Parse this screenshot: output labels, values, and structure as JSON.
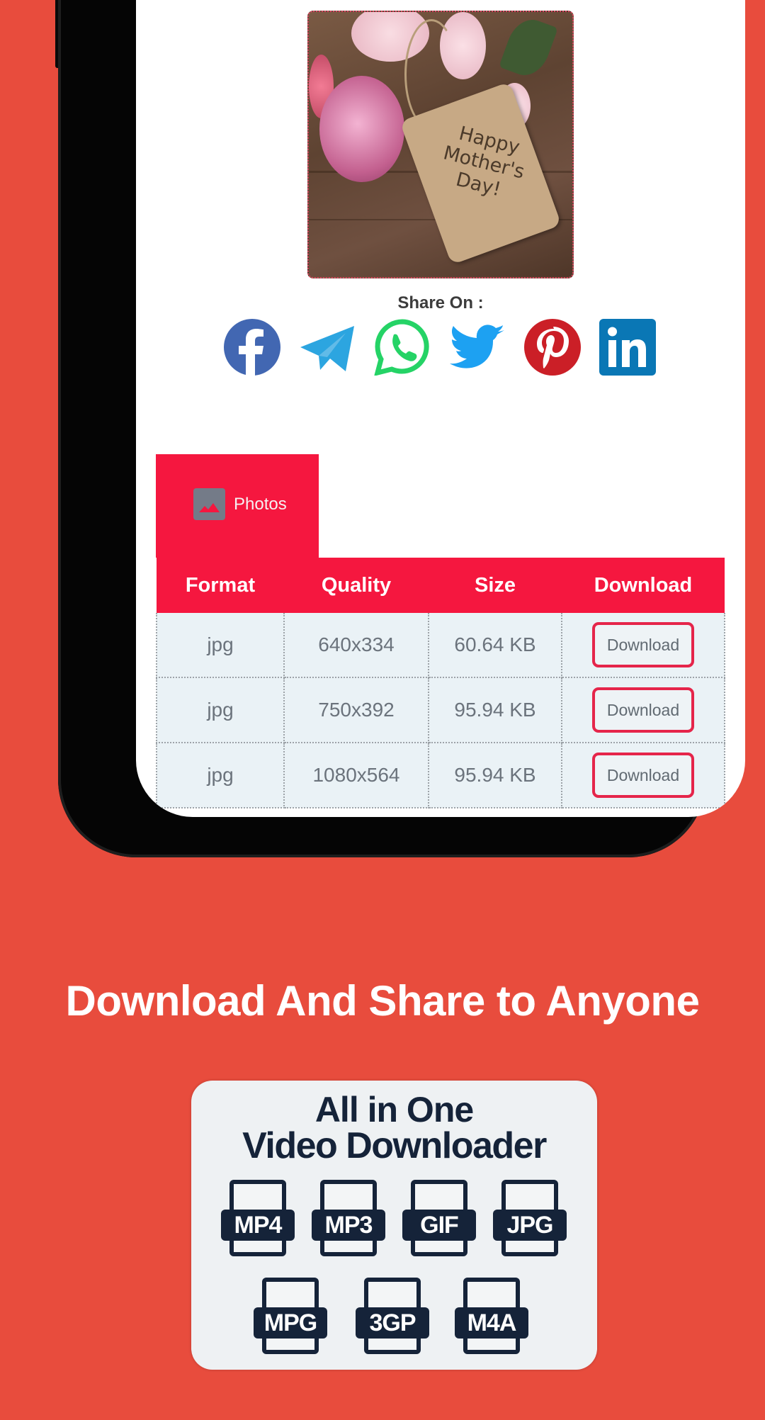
{
  "colors": {
    "background": "#e84c3d",
    "accent": "#f5173f",
    "download_button_border": "#e5254a",
    "table_cell_bg": "#eaf2f6",
    "promo_text": "#152339"
  },
  "preview_image": {
    "alt": "Happy Mother's Day card with pink roses",
    "tag_text": "Happy Mother's Day!"
  },
  "share": {
    "label": "Share On :",
    "networks": [
      {
        "name": "Facebook",
        "icon": "facebook-icon",
        "color": "#4267b2"
      },
      {
        "name": "Telegram",
        "icon": "telegram-icon",
        "color": "#2ca5e0"
      },
      {
        "name": "WhatsApp",
        "icon": "whatsapp-icon",
        "color": "#25d366"
      },
      {
        "name": "Twitter",
        "icon": "twitter-icon",
        "color": "#1da1f2"
      },
      {
        "name": "Pinterest",
        "icon": "pinterest-icon",
        "color": "#cb1f27"
      },
      {
        "name": "LinkedIn",
        "icon": "linkedin-icon",
        "color": "#0a77b5"
      }
    ]
  },
  "tabs": [
    {
      "label": "Photos",
      "icon": "image-icon",
      "active": true
    }
  ],
  "table": {
    "headers": [
      "Format",
      "Quality",
      "Size",
      "Download"
    ],
    "rows": [
      {
        "format": "jpg",
        "quality": "640x334",
        "size": "60.64 KB",
        "action": "Download"
      },
      {
        "format": "jpg",
        "quality": "750x392",
        "size": "95.94 KB",
        "action": "Download"
      },
      {
        "format": "jpg",
        "quality": "1080x564",
        "size": "95.94 KB",
        "action": "Download"
      }
    ]
  },
  "headline": "Download And Share to Anyone",
  "promo": {
    "line1": "All in One",
    "line2": "Video Downloader",
    "formats_row1": [
      "MP4",
      "MP3",
      "GIF",
      "JPG"
    ],
    "formats_row2": [
      "MPG",
      "3GP",
      "M4A"
    ]
  }
}
